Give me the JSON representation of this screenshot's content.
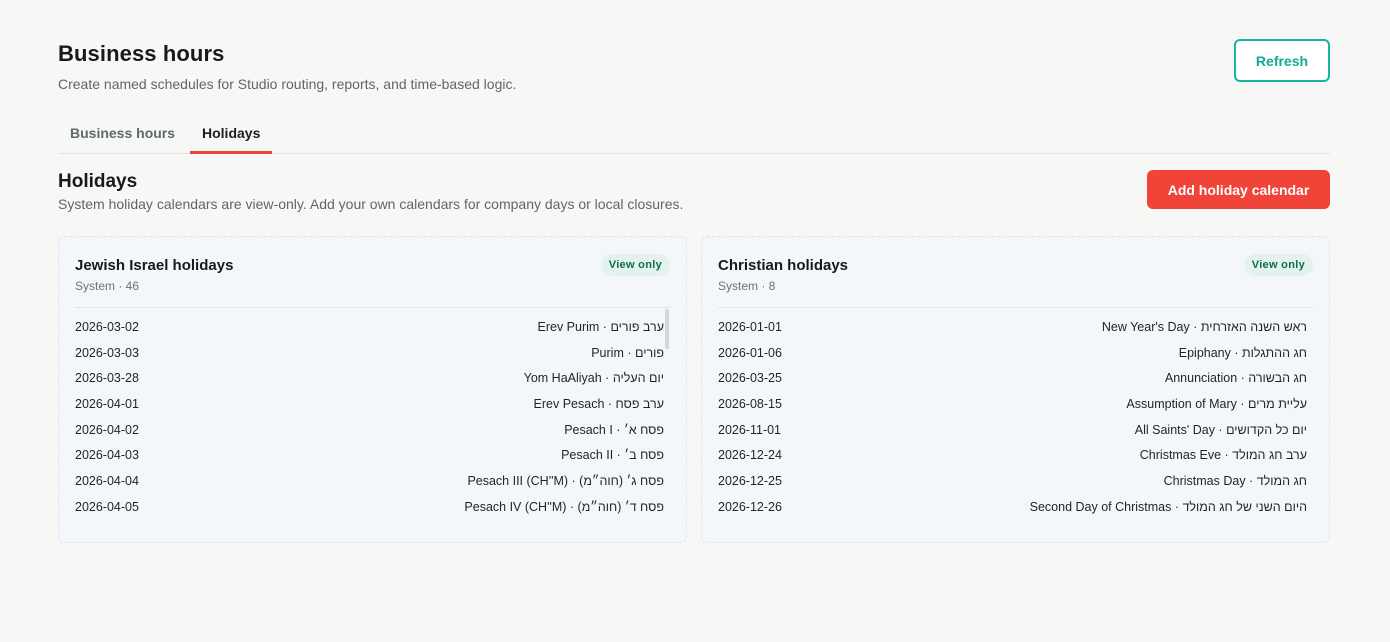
{
  "header": {
    "title": "Business hours",
    "subtitle": "Create named schedules for Studio routing, reports, and time-based logic.",
    "refresh_label": "Refresh"
  },
  "tabs": [
    {
      "label": "Business hours",
      "active": false
    },
    {
      "label": "Holidays",
      "active": true
    }
  ],
  "section": {
    "title": "Holidays",
    "subtitle": "System holiday calendars are view-only. Add your own calendars for company days or local closures.",
    "add_label": "Add holiday calendar"
  },
  "calendars": [
    {
      "title": "Jewish Israel holidays",
      "meta": "System · 46",
      "badge": "View only",
      "rows": [
        {
          "date": "2026-03-02",
          "name": "Erev Purim · ערב פורים"
        },
        {
          "date": "2026-03-03",
          "name": "Purim · פורים"
        },
        {
          "date": "2026-03-28",
          "name": "Yom HaAliyah · יום העליה"
        },
        {
          "date": "2026-04-01",
          "name": "Erev Pesach · ערב פסח"
        },
        {
          "date": "2026-04-02",
          "name": "Pesach I · פסח א׳"
        },
        {
          "date": "2026-04-03",
          "name": "Pesach II · פסח ב׳"
        },
        {
          "date": "2026-04-04",
          "name": "Pesach III (CH''M) · פסח ג׳ (חוה״מ)"
        },
        {
          "date": "2026-04-05",
          "name": "Pesach IV (CH''M) · פסח ד׳ (חוה״מ)"
        }
      ]
    },
    {
      "title": "Christian holidays",
      "meta": "System · 8",
      "badge": "View only",
      "rows": [
        {
          "date": "2026-01-01",
          "name": "New Year's Day · ראש השנה האזרחית"
        },
        {
          "date": "2026-01-06",
          "name": "Epiphany · חג ההתגלות"
        },
        {
          "date": "2026-03-25",
          "name": "Annunciation · חג הבשורה"
        },
        {
          "date": "2026-08-15",
          "name": "Assumption of Mary · עליית מרים"
        },
        {
          "date": "2026-11-01",
          "name": "All Saints' Day · יום כל הקדושים"
        },
        {
          "date": "2026-12-24",
          "name": "Christmas Eve · ערב חג המולד"
        },
        {
          "date": "2026-12-25",
          "name": "Christmas Day · חג המולד"
        },
        {
          "date": "2026-12-26",
          "name": "Second Day of Christmas · היום השני של חג המולד"
        }
      ]
    }
  ],
  "colors": {
    "accent_teal": "#17b3a3",
    "accent_red": "#f04438",
    "tab_indicator": "#ef4136",
    "badge_bg": "#e3f2ec",
    "badge_text": "#0e6b54"
  }
}
